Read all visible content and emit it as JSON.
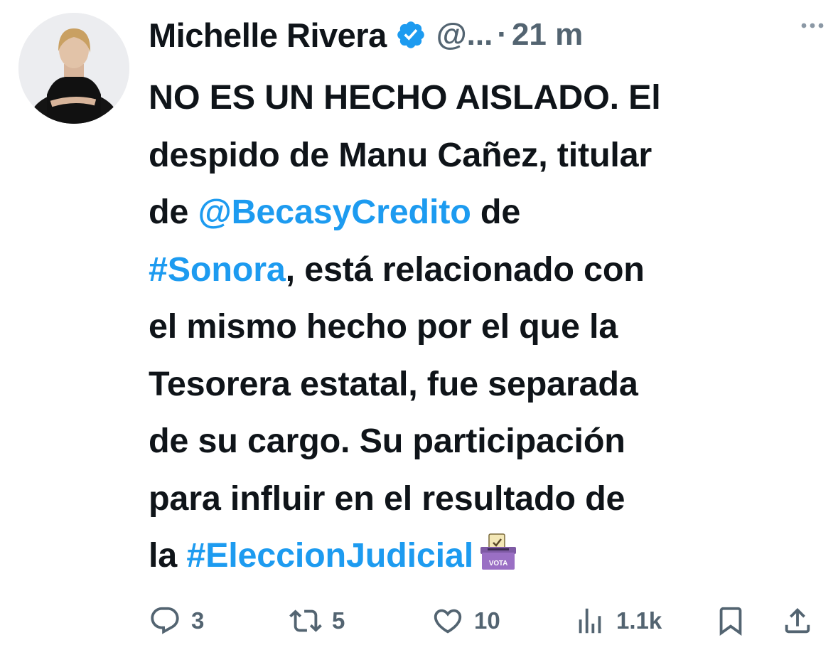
{
  "author": {
    "name": "Michelle Rivera",
    "handle": "@...",
    "separator": "·",
    "time": "21 m",
    "verified": true
  },
  "tweet": {
    "lines": [
      [
        {
          "t": "NO ES UN HECHO AISLADO. El"
        }
      ],
      [
        {
          "t": "despido de Manu Cañez, titular"
        }
      ],
      [
        {
          "t": "de "
        },
        {
          "t": "@BecasyCredito",
          "link": true
        },
        {
          "t": " de"
        }
      ],
      [
        {
          "t": "#Sonora",
          "link": true
        },
        {
          "t": ", está relacionado con"
        }
      ],
      [
        {
          "t": "el mismo hecho por el que la"
        }
      ],
      [
        {
          "t": "Tesorera estatal, fue separada"
        }
      ],
      [
        {
          "t": "de su cargo. Su participación"
        }
      ],
      [
        {
          "t": "para influir en el resultado de"
        }
      ],
      [
        {
          "t": "la "
        },
        {
          "t": "#EleccionJudicial",
          "link": true
        }
      ]
    ],
    "emoji": "ballot-box-icon",
    "emoji_label": "VOTA"
  },
  "actions": {
    "reply": {
      "icon": "reply-icon",
      "count": "3"
    },
    "retweet": {
      "icon": "retweet-icon",
      "count": "5"
    },
    "like": {
      "icon": "heart-icon",
      "count": "10"
    },
    "views": {
      "icon": "views-icon",
      "count": "1.1k"
    },
    "bookmark": {
      "icon": "bookmark-icon"
    },
    "share": {
      "icon": "share-icon"
    }
  },
  "colors": {
    "text": "#0f1419",
    "muted": "#536471",
    "link": "#1d9bf0",
    "verified": "#1d9bf0"
  }
}
